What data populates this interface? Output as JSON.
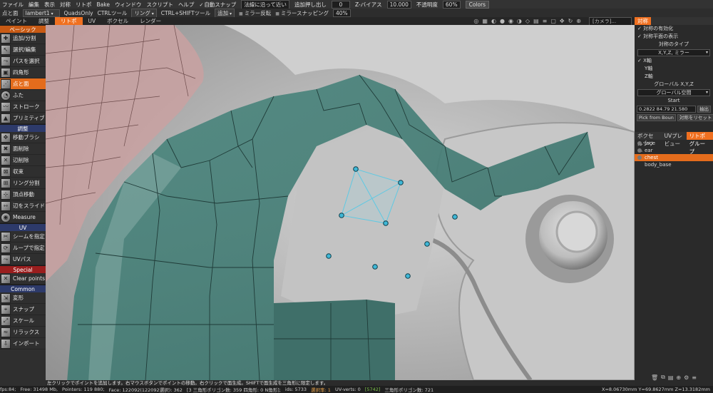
{
  "menubar": {
    "items": [
      "ファイル",
      "編集",
      "表示",
      "対称",
      "リトポ",
      "Bake",
      "ウィンドウ",
      "スクリプト",
      "ヘルプ"
    ],
    "auto_snap": "自動スナップ",
    "snap_mode_label": "法線に沿って近い",
    "add_extrude_label": "追加押し出し",
    "add_extrude_value": "0",
    "z_bias_label": "Z-バイアス",
    "z_bias_value": "10.000",
    "opacity_label": "不透明度",
    "opacity_value": "60%",
    "colors_button": "Colors"
  },
  "toolrow": {
    "tool_name": "点と面",
    "layer_select": "lambert1",
    "quads_only": "QuadsOnly",
    "ctrl_tool": "CTRLツール",
    "ctrl_tool_value": "リング",
    "ctrl_shift_tool": "CTRL+SHIFTツール",
    "ctrl_shift_value": "追加",
    "mirror_label": "ミラー反転",
    "mirror_snap_label": "ミラースナッピング",
    "mirror_snap_value": "40%"
  },
  "tabs": [
    "ペイント",
    "調整",
    "リトポ",
    "UV",
    "ボクセル",
    "レンダー"
  ],
  "active_tab": "リトポ",
  "camera_select": "[カメラ]...",
  "left_panel": {
    "sections": [
      {
        "title": "ベーシック",
        "tools": [
          "追加/分割",
          "選択/編集",
          "パスを選択",
          "四角形",
          "点と面",
          "ふた",
          "ストローク",
          "プリミティブ"
        ]
      },
      {
        "title": "調整",
        "tools": [
          "移動ブラシ",
          "面削除",
          "辺削除",
          "収束",
          "リング分割",
          "頂点移動",
          "辺をスライド",
          "Measure"
        ]
      },
      {
        "title": "UV",
        "tools": [
          "シームを指定",
          "ループで指定",
          "UVパス"
        ]
      },
      {
        "title": "Special",
        "tools": [
          "Clear points"
        ]
      },
      {
        "title": "Common",
        "tools": [
          "変形",
          "スナップ",
          "スケール",
          "リラックス",
          "インポート"
        ]
      }
    ],
    "active_tool": "点と面"
  },
  "right_panel": {
    "title": "対称",
    "enable_symmetry": "対称の有効化",
    "show_plane": "対称平面の表示",
    "symmetry_type_label": "対称のタイプ",
    "symmetry_type_value": "X,Y,Z, ミラー",
    "x_axis": "X軸",
    "y_axis": "Y軸",
    "z_axis": "Z軸",
    "global_label": "グローバル  X,Y,Z",
    "global_space": "グローバル空間",
    "start_label": "Start",
    "start_values": "0.2822 84.79 21.580",
    "extract_button": "抽出",
    "pick_button": "Pick from Boun",
    "reset_button": "対称をリセット",
    "tabs": [
      "ボクセルツリー",
      "UVプレビュー",
      "リトポグループ"
    ],
    "active_tab": "リトポグループ",
    "groups": [
      "face",
      "ear",
      "chest",
      "body_base"
    ],
    "active_group": "chest"
  },
  "hint_text": "左クリックでポイントを追加します。右マウスボタンでポイントの移動。右クリックで面生成。SHIFTで面生成を三角形に限定します。",
  "statusbar": {
    "fps": "fps:84;",
    "free": "Free: 31498 Mb,",
    "points": "Pointers: 119 880;",
    "faces": "Face: 122092(122092選択): 362",
    "tri_faces": "[3 三角形ポリゴン数: 359 四角形: 0 N角形];",
    "ids": "ids: 5733",
    "sel": "選択率: 1",
    "uv_verts_label": "UV-verts: 0",
    "uv_verts_val": "[5742]",
    "tri_poly": "三角形ポリゴン数: 721",
    "coords": "X=8.06730mm  Y=69.8627mm  Z=13.3182mm"
  }
}
